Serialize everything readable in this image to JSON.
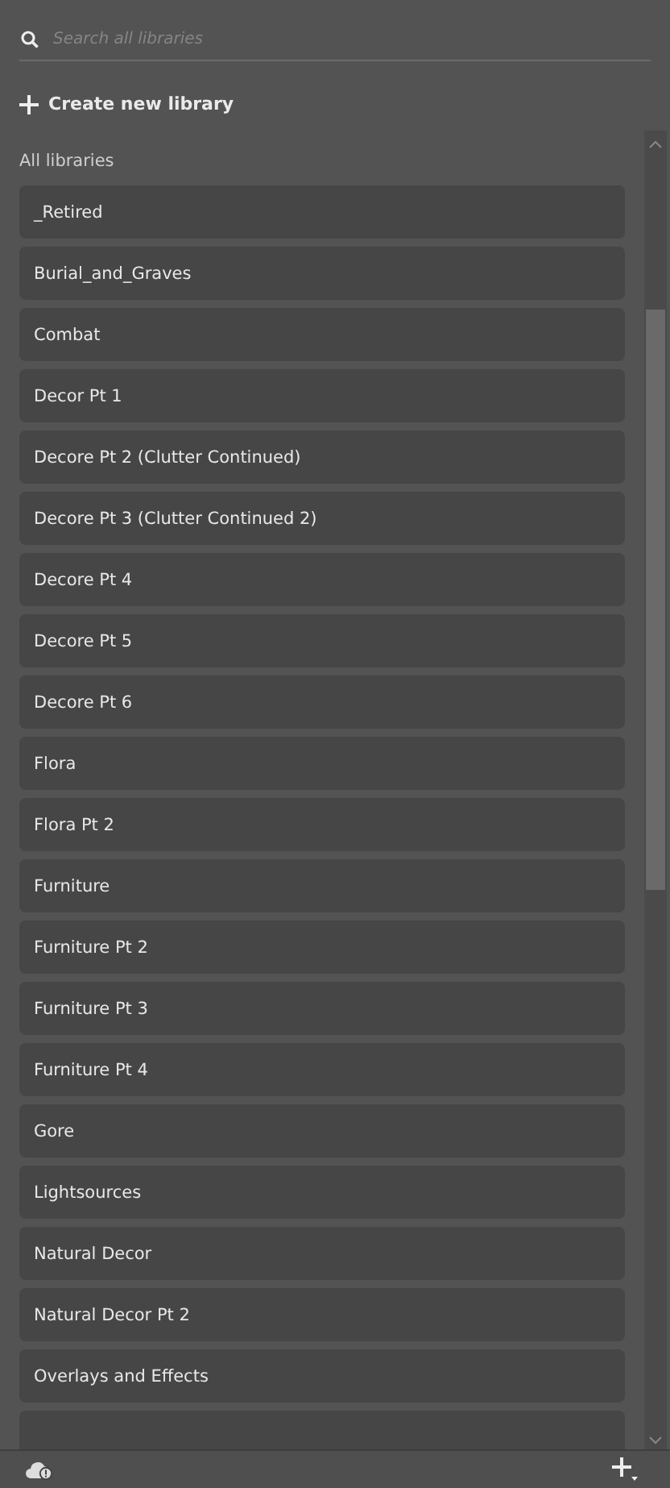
{
  "search": {
    "placeholder": "Search all libraries"
  },
  "create_button": {
    "label": "Create new library"
  },
  "section_title": "All libraries",
  "libraries": [
    {
      "name": "_Retired"
    },
    {
      "name": "Burial_and_Graves"
    },
    {
      "name": "Combat"
    },
    {
      "name": "Decor Pt 1"
    },
    {
      "name": "Decore Pt 2 (Clutter Continued)"
    },
    {
      "name": "Decore Pt 3 (Clutter Continued 2)"
    },
    {
      "name": "Decore Pt 4"
    },
    {
      "name": "Decore Pt 5"
    },
    {
      "name": "Decore Pt 6"
    },
    {
      "name": "Flora"
    },
    {
      "name": "Flora Pt 2"
    },
    {
      "name": "Furniture"
    },
    {
      "name": "Furniture Pt 2"
    },
    {
      "name": "Furniture Pt 3"
    },
    {
      "name": "Furniture Pt 4"
    },
    {
      "name": "Gore"
    },
    {
      "name": "Lightsources"
    },
    {
      "name": "Natural Decor"
    },
    {
      "name": "Natural Decor Pt 2"
    },
    {
      "name": "Overlays and Effects"
    }
  ]
}
